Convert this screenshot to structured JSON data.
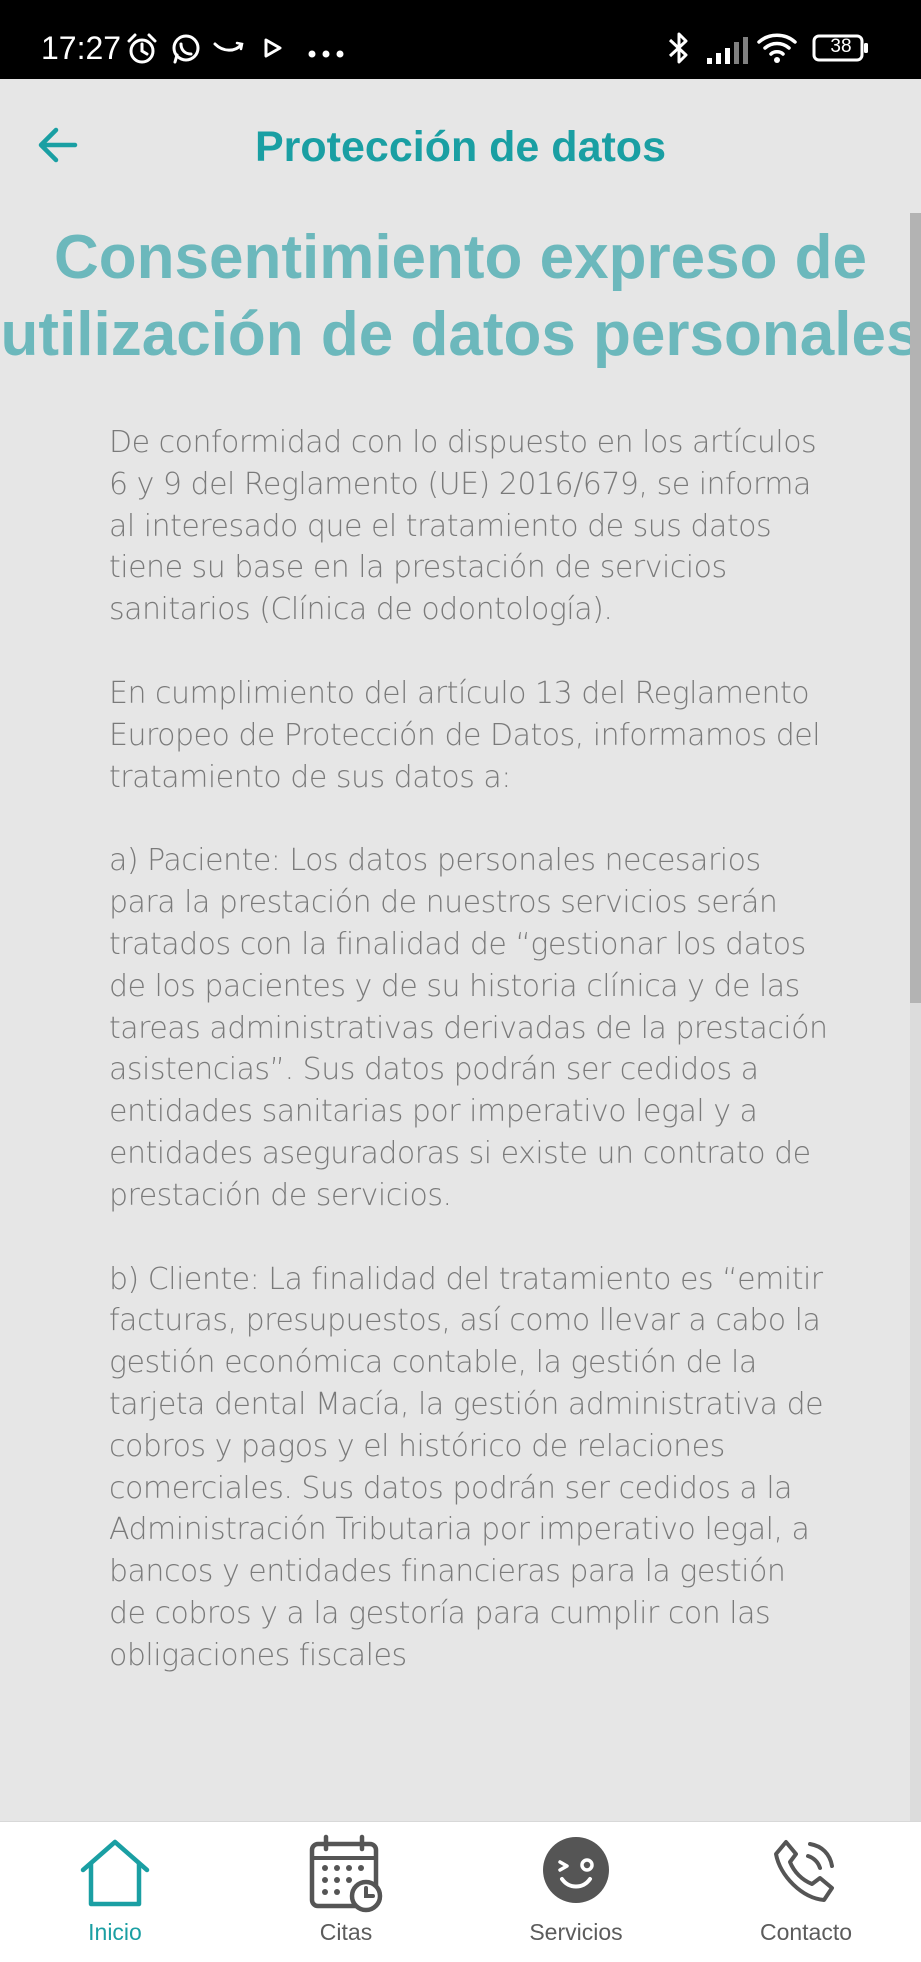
{
  "status_bar": {
    "time": "17:27",
    "battery_level": "38",
    "icons": [
      "alarm-icon",
      "whatsapp-icon",
      "amazon-icon",
      "play-icon",
      "more-dots-icon",
      "bluetooth-icon",
      "signal-icon",
      "wifi-icon",
      "battery-icon"
    ]
  },
  "header": {
    "title": "Protección de datos",
    "back_icon": "arrow-left-icon"
  },
  "colors": {
    "accent": "#1a9fa3",
    "heading": "#6cb8bc",
    "body_text": "#7a7a7a",
    "background": "#e6e6e6"
  },
  "content": {
    "heading_line1": "Consentimiento expreso de",
    "heading_line2": "utilización de datos personales",
    "paragraphs": [
      "De conformidad con lo dispuesto en los artículos 6 y 9 del Reglamento (UE) 2016/679, se informa al interesado que el tratamiento de sus datos tiene su base en la prestación de servicios sanitarios (Clínica de odontología).",
      "En cumplimiento del artículo 13 del Reglamento Europeo de Protección de Datos, informamos del tratamiento de sus datos a:",
      "a) Paciente: Los datos personales necesarios para la prestación de nuestros servicios serán tratados con la finalidad de “gestionar los datos de los pacientes y de su historia clínica y de las tareas administrativas derivadas de la prestación asistencias”. Sus datos podrán ser cedidos a entidades sanitarias por imperativo legal y a entidades aseguradoras si existe un contrato de prestación de servicios.",
      "b) Cliente: La finalidad del tratamiento es “emitir facturas, presupuestos, así como llevar a cabo la gestión económica contable, la gestión de la tarjeta dental Macía, la gestión administrativa de cobros y pagos y el histórico de relaciones comerciales. Sus datos podrán ser cedidos a la Administración Tributaria por imperativo legal, a bancos y entidades financieras para la gestión de cobros y a la gestoría para cumplir con las obligaciones fiscales"
    ]
  },
  "bottom_nav": {
    "items": [
      {
        "label": "Inicio",
        "icon": "home-icon",
        "active": true
      },
      {
        "label": "Citas",
        "icon": "calendar-icon",
        "active": false
      },
      {
        "label": "Servicios",
        "icon": "smile-face-icon",
        "active": false
      },
      {
        "label": "Contacto",
        "icon": "phone-icon",
        "active": false
      }
    ]
  }
}
